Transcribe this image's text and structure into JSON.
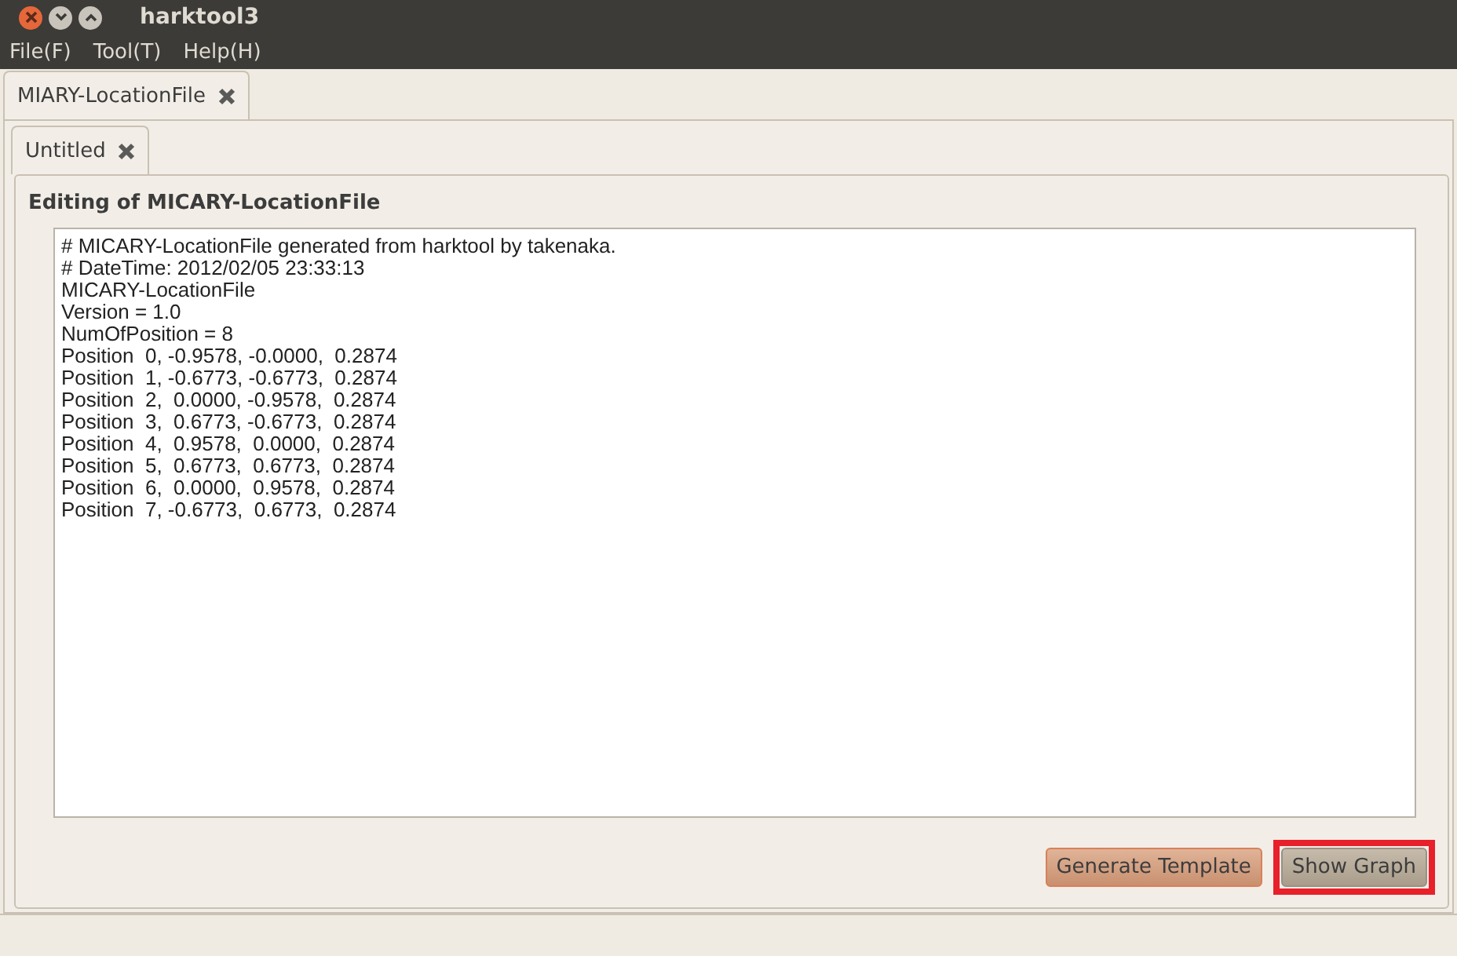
{
  "window": {
    "title": "harktool3"
  },
  "menu": [
    {
      "label": "File(F)"
    },
    {
      "label": "Tool(T)"
    },
    {
      "label": "Help(H)"
    }
  ],
  "outer_tabs": [
    {
      "label": "MIARY-LocationFile",
      "selected": true
    }
  ],
  "inner_tabs": [
    {
      "label": "Untitled",
      "selected": true
    }
  ],
  "editor": {
    "heading": "Editing of MICARY-LocationFile",
    "lines": [
      "# MICARY-LocationFile generated from harktool by takenaka.",
      "# DateTime: 2012/02/05 23:33:13",
      "MICARY-LocationFile",
      "Version = 1.0",
      "NumOfPosition = 8",
      "Position  0, -0.9578, -0.0000,  0.2874",
      "Position  1, -0.6773, -0.6773,  0.2874",
      "Position  2,  0.0000, -0.9578,  0.2874",
      "Position  3,  0.6773, -0.6773,  0.2874",
      "Position  4,  0.9578,  0.0000,  0.2874",
      "Position  5,  0.6773,  0.6773,  0.2874",
      "Position  6,  0.0000,  0.9578,  0.2874",
      "Position  7, -0.6773,  0.6773,  0.2874"
    ]
  },
  "buttons": [
    {
      "label": "Generate Template",
      "focused": true,
      "highlighted": false
    },
    {
      "label": "Show Graph",
      "focused": false,
      "highlighted": true
    }
  ]
}
